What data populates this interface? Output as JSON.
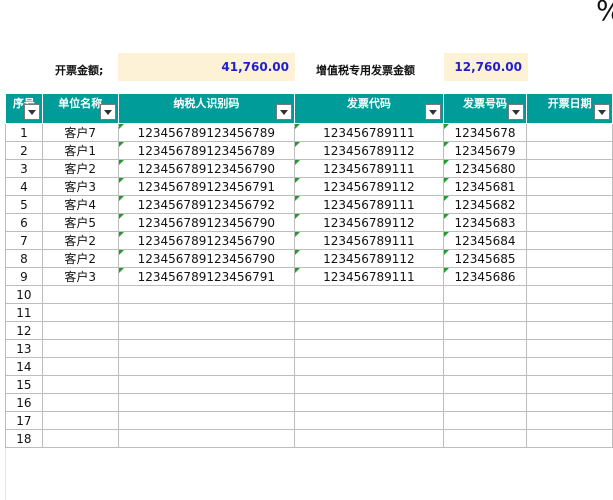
{
  "corner": {
    "glyph": "%"
  },
  "summary": {
    "invoice_amount_label": "开票金额;",
    "invoice_amount_value": "41,760.00",
    "vat_amount_label": "增值税专用发票金额",
    "vat_amount_value": "12,760.00"
  },
  "headers": [
    "序号",
    "单位名称",
    "纳税人识别码",
    "发票代码",
    "发票号码",
    "开票日期"
  ],
  "rows": [
    {
      "no": "1",
      "unit": "客户7",
      "tax_id": "123456789123456789",
      "code": "123456789111",
      "number": "12345678",
      "date": ""
    },
    {
      "no": "2",
      "unit": "客户1",
      "tax_id": "123456789123456789",
      "code": "123456789112",
      "number": "12345679",
      "date": ""
    },
    {
      "no": "3",
      "unit": "客户2",
      "tax_id": "123456789123456790",
      "code": "123456789111",
      "number": "12345680",
      "date": ""
    },
    {
      "no": "4",
      "unit": "客户3",
      "tax_id": "123456789123456791",
      "code": "123456789112",
      "number": "12345681",
      "date": ""
    },
    {
      "no": "5",
      "unit": "客户4",
      "tax_id": "123456789123456792",
      "code": "123456789111",
      "number": "12345682",
      "date": ""
    },
    {
      "no": "6",
      "unit": "客户5",
      "tax_id": "123456789123456790",
      "code": "123456789112",
      "number": "12345683",
      "date": ""
    },
    {
      "no": "7",
      "unit": "客户2",
      "tax_id": "123456789123456790",
      "code": "123456789111",
      "number": "12345684",
      "date": ""
    },
    {
      "no": "8",
      "unit": "客户2",
      "tax_id": "123456789123456790",
      "code": "123456789112",
      "number": "12345685",
      "date": ""
    },
    {
      "no": "9",
      "unit": "客户3",
      "tax_id": "123456789123456791",
      "code": "123456789111",
      "number": "12345686",
      "date": ""
    },
    {
      "no": "10",
      "unit": "",
      "tax_id": "",
      "code": "",
      "number": "",
      "date": ""
    },
    {
      "no": "11",
      "unit": "",
      "tax_id": "",
      "code": "",
      "number": "",
      "date": ""
    },
    {
      "no": "12",
      "unit": "",
      "tax_id": "",
      "code": "",
      "number": "",
      "date": ""
    },
    {
      "no": "13",
      "unit": "",
      "tax_id": "",
      "code": "",
      "number": "",
      "date": ""
    },
    {
      "no": "14",
      "unit": "",
      "tax_id": "",
      "code": "",
      "number": "",
      "date": ""
    },
    {
      "no": "15",
      "unit": "",
      "tax_id": "",
      "code": "",
      "number": "",
      "date": ""
    },
    {
      "no": "16",
      "unit": "",
      "tax_id": "",
      "code": "",
      "number": "",
      "date": ""
    },
    {
      "no": "17",
      "unit": "",
      "tax_id": "",
      "code": "",
      "number": "",
      "date": ""
    },
    {
      "no": "18",
      "unit": "",
      "tax_id": "",
      "code": "",
      "number": "",
      "date": ""
    }
  ],
  "colors": {
    "header_bg": "#009c99",
    "summary_bg": "#fdf2d6",
    "id_text": "#2323c9",
    "comment_marker": "#1f9e2a"
  }
}
